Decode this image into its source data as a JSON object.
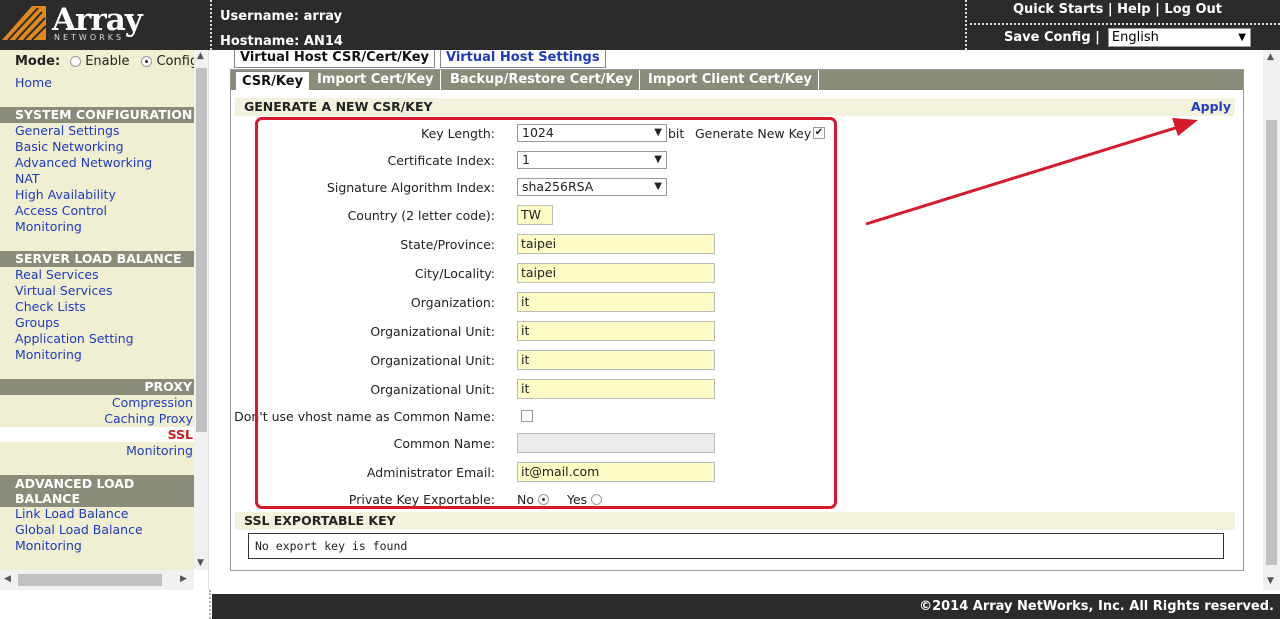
{
  "header": {
    "logo_text": "Array",
    "logo_sub": "NETWORKS",
    "username_label": "Username: array",
    "hostname_label": "Hostname: AN14",
    "links": [
      "Quick Starts",
      "Help",
      "Log Out"
    ],
    "save_config": "Save Config",
    "language": "English"
  },
  "sidebar": {
    "mode_label": "Mode:",
    "mode_options": [
      "Enable",
      "Config"
    ],
    "home": "Home",
    "sections": [
      {
        "title": "SYSTEM CONFIGURATION",
        "items": [
          "General Settings",
          "Basic Networking",
          "Advanced Networking",
          "NAT",
          "High Availability",
          "Access Control",
          "Monitoring"
        ]
      },
      {
        "title": "SERVER LOAD BALANCE",
        "items": [
          "Real Services",
          "Virtual Services",
          "Check Lists",
          "Groups",
          "Application Setting",
          "Monitoring"
        ]
      },
      {
        "title": "PROXY",
        "items": [
          "Compression",
          "Caching Proxy",
          "SSL",
          "Monitoring"
        ]
      },
      {
        "title": "ADVANCED LOAD BALANCE",
        "items": [
          "Link Load Balance",
          "Global Load Balance",
          "Monitoring"
        ]
      }
    ],
    "active_item": "SSL"
  },
  "tabs": {
    "top": [
      "Virtual Host CSR/Cert/Key",
      "Virtual Host Settings"
    ],
    "sub": [
      "CSR/Key",
      "Import Cert/Key",
      "Backup/Restore Cert/Key",
      "Import Client Cert/Key"
    ]
  },
  "csr": {
    "heading": "GENERATE A NEW CSR/KEY",
    "apply": "Apply",
    "key_length_label": "Key Length:",
    "key_length_value": "1024",
    "key_length_unit": "bit",
    "generate_new_key_label": "Generate New Key",
    "generate_new_key_mark": "✔",
    "cert_index_label": "Certificate Index:",
    "cert_index_value": "1",
    "sig_alg_label": "Signature Algorithm Index:",
    "sig_alg_value": "sha256RSA",
    "country_label": "Country (2 letter code):",
    "country_value": "TW",
    "state_label": "State/Province:",
    "state_value": "taipei",
    "city_label": "City/Locality:",
    "city_value": "taipei",
    "org_label": "Organization:",
    "org_value": "it",
    "org_unit_label": "Organizational Unit:",
    "org_unit_values": [
      "it",
      "it",
      "it"
    ],
    "no_vhost_label": "Don't use vhost name as Common Name:",
    "common_name_label": "Common Name:",
    "admin_email_label": "Administrator Email:",
    "admin_email_value": "it@mail.com",
    "exportable_label": "Private Key Exportable:",
    "exportable_options": [
      "No",
      "Yes"
    ]
  },
  "ssl_export": {
    "heading": "SSL EXPORTABLE KEY",
    "message": "No export key is found"
  },
  "footer": {
    "copyright": "©2014 Array NetWorks, Inc. All Rights reserved."
  }
}
